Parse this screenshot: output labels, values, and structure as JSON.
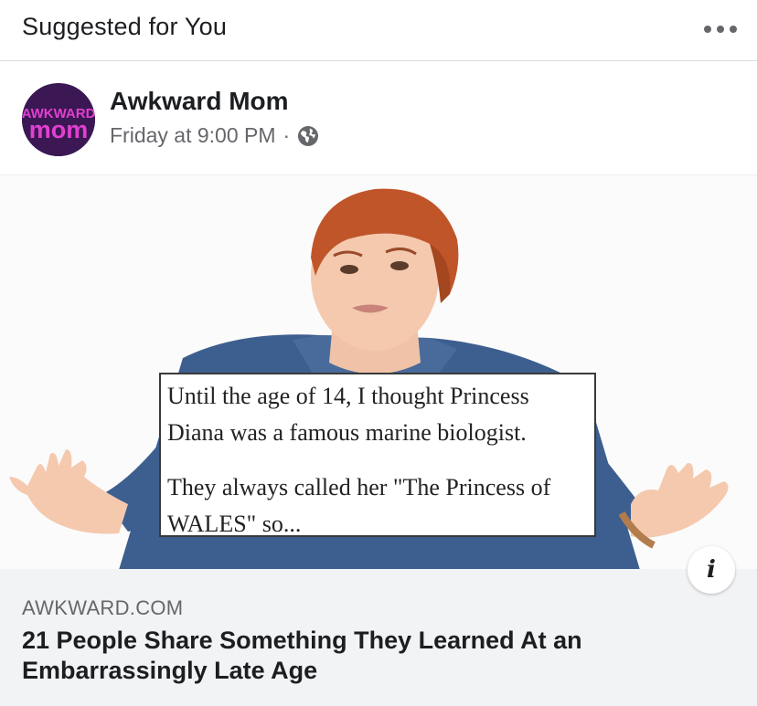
{
  "header": {
    "title": "Suggested for You",
    "more_icon": "more-horizontal-icon"
  },
  "post": {
    "page_name": "Awkward Mom",
    "avatar_text_top": "AWKWARD",
    "avatar_text_bottom": "mom",
    "timestamp": "Friday at 9:00 PM",
    "separator": "·",
    "privacy_icon": "globe-icon"
  },
  "image": {
    "quote_line1": "Until the age of 14, I thought Princess Diana was a famous marine biologist.",
    "quote_line2": "They always called her \"The Princess of WALES\" so...",
    "info_label": "i"
  },
  "link": {
    "domain": "AWKWARD.COM",
    "headline": "21 People Share Something They Learned At an Embarrassingly Late Age"
  },
  "colors": {
    "avatar_bg": "#3b1854",
    "avatar_text": "#e23fd0",
    "secondary_text": "#65676b",
    "footer_bg": "#f2f3f5"
  }
}
